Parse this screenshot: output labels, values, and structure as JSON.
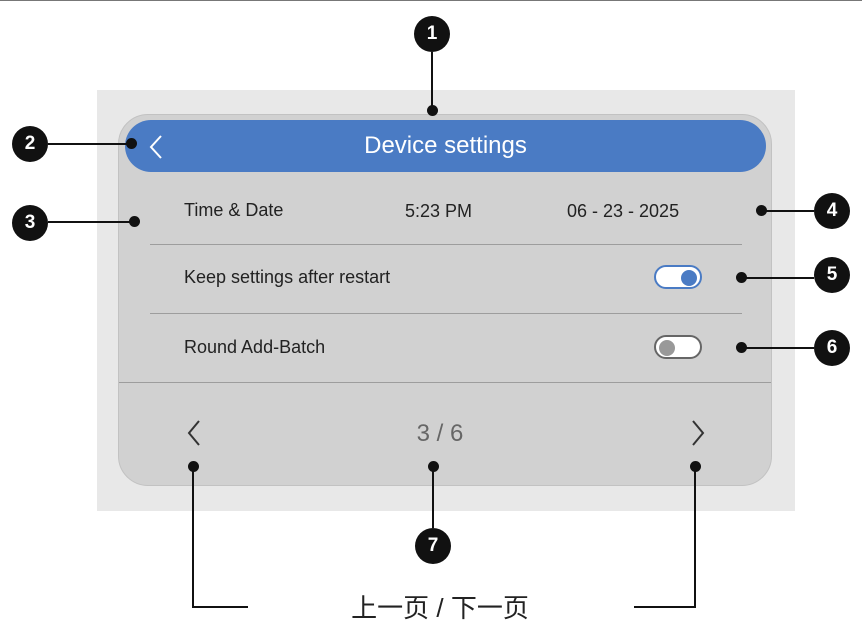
{
  "header": {
    "title": "Device settings",
    "back_icon": "chevron-left-icon"
  },
  "rows": {
    "time_date": {
      "label": "Time & Date",
      "time": "5:23 PM",
      "date": "06 - 23 - 2025"
    },
    "keep_settings": {
      "label": "Keep settings after restart",
      "toggle_on": true
    },
    "round_add_batch": {
      "label": "Round Add-Batch",
      "toggle_on": false
    }
  },
  "pagination": {
    "indicator": "3 / 6",
    "prev_icon": "chevron-left-icon",
    "next_icon": "chevron-right-icon"
  },
  "callouts": [
    "1",
    "2",
    "3",
    "4",
    "5",
    "6",
    "7"
  ],
  "caption": "上一页 / 下一页",
  "colors": {
    "accent": "#4a7bc4",
    "screen_bg": "#d1d1d1",
    "backdrop": "#e8e8e8",
    "callout": "#111111"
  }
}
